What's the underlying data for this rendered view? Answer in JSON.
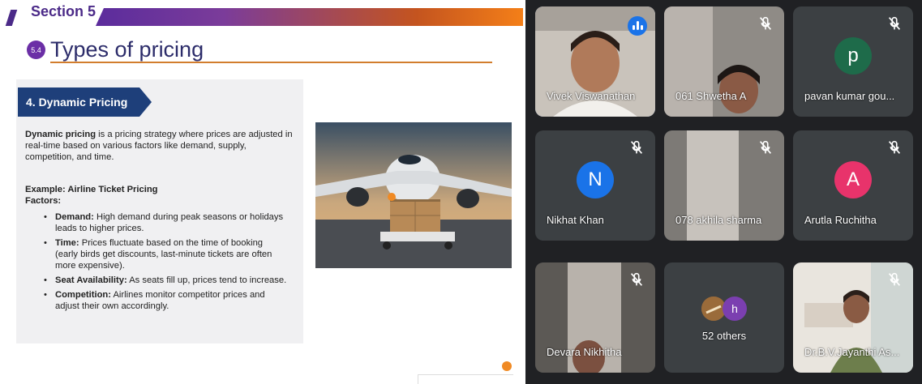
{
  "slide": {
    "section_label": "Section 5",
    "section_number": "5.4",
    "title": "Types of pricing",
    "banner": "4. Dynamic Pricing",
    "intro_bold": "Dynamic pricing",
    "intro_rest": " is a pricing strategy where prices are adjusted in real-time based on various factors like demand, supply, competition, and time.",
    "example_title": "Example: Airline Ticket Pricing",
    "factors_title": "Factors:",
    "factors": [
      {
        "term": "Demand:",
        "text": " High demand during peak seasons or holidays leads to higher prices."
      },
      {
        "term": "Time:",
        "text": " Prices fluctuate based on the time of booking (early birds get discounts, last-minute tickets are often more expensive)."
      },
      {
        "term": "Seat Availability:",
        "text": " As seats fill up, prices tend to increase."
      },
      {
        "term": "Competition:",
        "text": " Airlines monitor competitor prices and adjust their own accordingly."
      }
    ],
    "image_icon": "airplane-cargo-photo"
  },
  "participants": [
    {
      "name": "Vivek Viswanathan",
      "type": "video",
      "speaking": true,
      "muted": false
    },
    {
      "name": "061 Shwetha A",
      "type": "video",
      "muted": true
    },
    {
      "name": "pavan kumar gou...",
      "type": "avatar",
      "initial": "p",
      "color": "#1e6b4a",
      "muted": true
    },
    {
      "name": "Nikhat Khan",
      "type": "avatar",
      "initial": "N",
      "color": "#1a73e8",
      "muted": true
    },
    {
      "name": "078 akhila sharma",
      "type": "video",
      "muted": true
    },
    {
      "name": "Arutla Ruchitha",
      "type": "avatar",
      "initial": "A",
      "color": "#e8336b",
      "muted": true
    },
    {
      "name": "Devara Nikhitha",
      "type": "video",
      "muted": true
    },
    {
      "name": "52 others",
      "type": "group",
      "initial": "h",
      "color": "#7b3fb0"
    },
    {
      "name": "Dr.B.V.Jayanthi As...",
      "type": "video",
      "muted": true
    }
  ],
  "icons": {
    "mute": "mic-off-icon",
    "speaking": "audio-level-icon"
  }
}
